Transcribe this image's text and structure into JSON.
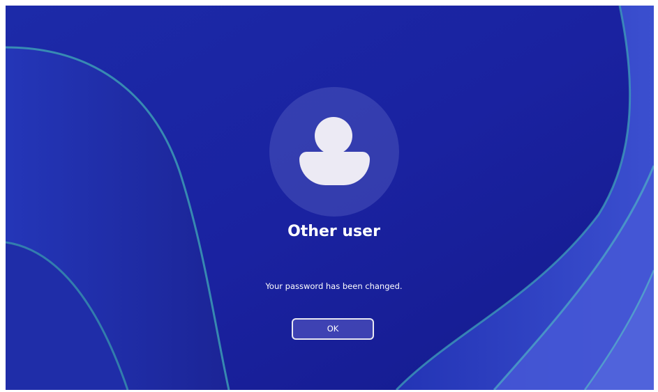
{
  "lock_screen": {
    "user_name": "Other user",
    "message": "Your password has been changed.",
    "ok_label": "OK",
    "avatar_icon": "person-icon"
  },
  "colors": {
    "wallpaper_base": "#1a23a0",
    "wallpaper_accent": "#3e4fd0",
    "text": "#ffffff",
    "button_border": "#e8e8f2"
  }
}
